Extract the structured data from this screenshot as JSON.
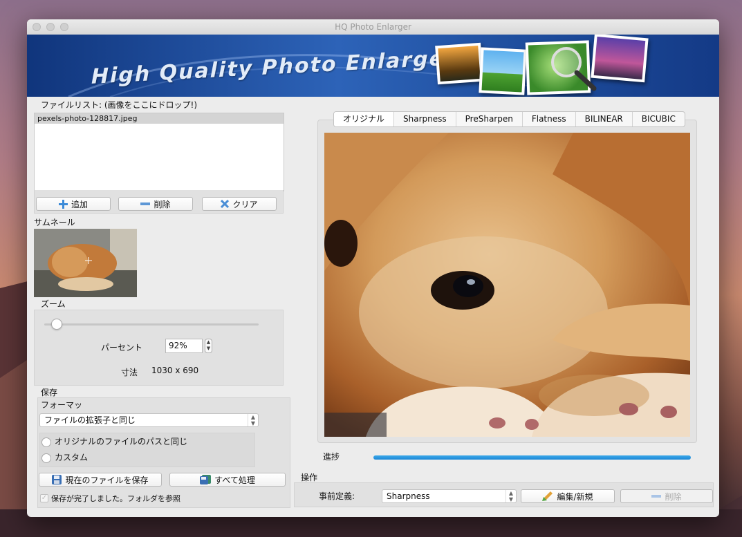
{
  "window": {
    "title": "HQ Photo Enlarger"
  },
  "banner": {
    "title": "High Quality Photo Enlarger"
  },
  "file_list": {
    "label": "ファイルリスト: (画像をここにドロップ!)",
    "items": [
      "pexels-photo-128817.jpeg"
    ]
  },
  "file_buttons": {
    "add": "追加",
    "remove": "削除",
    "clear": "クリア"
  },
  "thumbnail": {
    "label": "サムネール"
  },
  "zoom": {
    "label": "ズーム",
    "percent_label": "パーセント",
    "percent_value": "92%",
    "size_label": "寸法",
    "size_value": "1030 x 690",
    "slider_level": 0.06
  },
  "save": {
    "label": "保存",
    "format_label": "フォーマッ",
    "format_value": "ファイルの拡張子と同じ",
    "radio_same_path": "オリジナルのファイルのパスと同じ",
    "radio_custom": "カスタム",
    "save_current": "現在のファイルを保存",
    "process_all": "すべて処理",
    "open_folder_check": "保存が完了しました。フォルダを参照"
  },
  "tabs": [
    "オリジナル",
    "Sharpness",
    "PreSharpen",
    "Flatness",
    "BILINEAR",
    "BICUBIC"
  ],
  "active_tab": "オリジナル",
  "progress": {
    "label": "進捗",
    "value": 1.0
  },
  "operations": {
    "label": "操作",
    "preset_label": "事前定義:",
    "preset_value": "Sharpness",
    "edit_new": "編集/新規",
    "delete": "削除"
  },
  "colors": {
    "progress": "#1d87d6",
    "banner": "#2d63b8",
    "window_bg": "#ececec"
  }
}
